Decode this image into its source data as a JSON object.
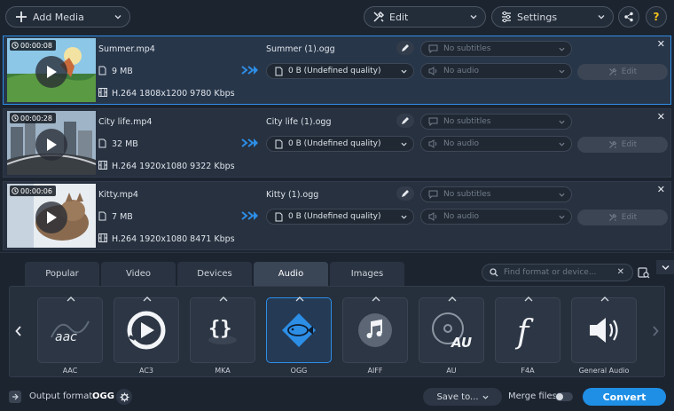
{
  "toolbar": {
    "add_media": "Add Media",
    "edit": "Edit",
    "settings": "Settings",
    "share_icon": "share-icon",
    "help": "?"
  },
  "rows": [
    {
      "duration": "00:00:08",
      "filename": "Summer.mp4",
      "size": "9 MB",
      "codec": "H.264 1808x1200 9780 Kbps",
      "output_name": "Summer (1).ogg",
      "output_size": "0 B (Undefined quality)",
      "subtitles": "No subtitles",
      "audio": "No audio",
      "edit": "Edit",
      "selected": true
    },
    {
      "duration": "00:00:28",
      "filename": "City life.mp4",
      "size": "32 MB",
      "codec": "H.264 1920x1080 9322 Kbps",
      "output_name": "City life (1).ogg",
      "output_size": "0 B (Undefined quality)",
      "subtitles": "No subtitles",
      "audio": "No audio",
      "edit": "Edit",
      "selected": false
    },
    {
      "duration": "00:00:06",
      "filename": "Kitty.mp4",
      "size": "7 MB",
      "codec": "H.264 1920x1080 8471 Kbps",
      "output_name": "Kitty (1).ogg",
      "output_size": "0 B (Undefined quality)",
      "subtitles": "No subtitles",
      "audio": "No audio",
      "edit": "Edit",
      "selected": false
    }
  ],
  "tabs": [
    "Popular",
    "Video",
    "Devices",
    "Audio",
    "Images"
  ],
  "active_tab": "Audio",
  "search": {
    "placeholder": "Find format or device..."
  },
  "formats": [
    "AAC",
    "AC3",
    "MKA",
    "OGG",
    "AIFF",
    "AU",
    "F4A",
    "General Audio"
  ],
  "selected_format": "OGG",
  "footer": {
    "output_format_label": "Output format:",
    "output_format_value": "OGG",
    "save_to": "Save to...",
    "merge_files": "Merge files:",
    "convert": "Convert"
  },
  "colors": {
    "accent": "#1f8fe6",
    "selection": "#2d8ee6",
    "background": "#1c2430"
  }
}
